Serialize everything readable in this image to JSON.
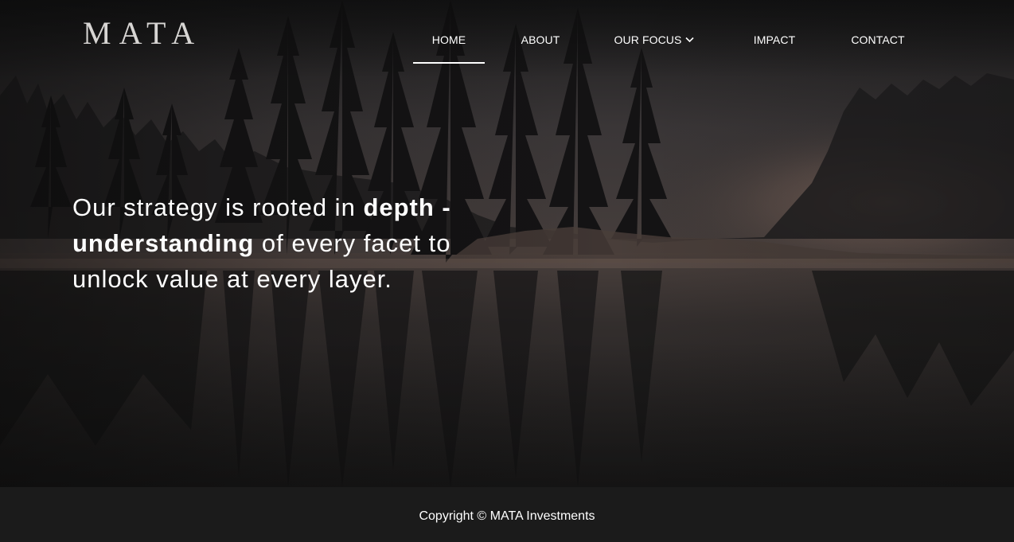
{
  "brand": {
    "logo_text": "MATA"
  },
  "nav": {
    "items": [
      {
        "label": "HOME",
        "active": true
      },
      {
        "label": "ABOUT",
        "active": false
      },
      {
        "label": "OUR FOCUS",
        "active": false,
        "has_dropdown": true
      },
      {
        "label": "IMPACT",
        "active": false
      },
      {
        "label": "CONTACT",
        "active": false
      }
    ],
    "dropdown_icon": "chevron-down-icon"
  },
  "hero": {
    "tagline_part1": "Our strategy is rooted in ",
    "tagline_bold1": "depth - understanding",
    "tagline_part2": " of every facet to unlock value at every layer.",
    "background_description_icon": "forest-lake-image"
  },
  "footer": {
    "copyright": "Copyright © MATA Investments"
  },
  "colors": {
    "text": "#ffffff",
    "logo": "#d7d5d3",
    "footer_bg": "#1b1b1b"
  }
}
